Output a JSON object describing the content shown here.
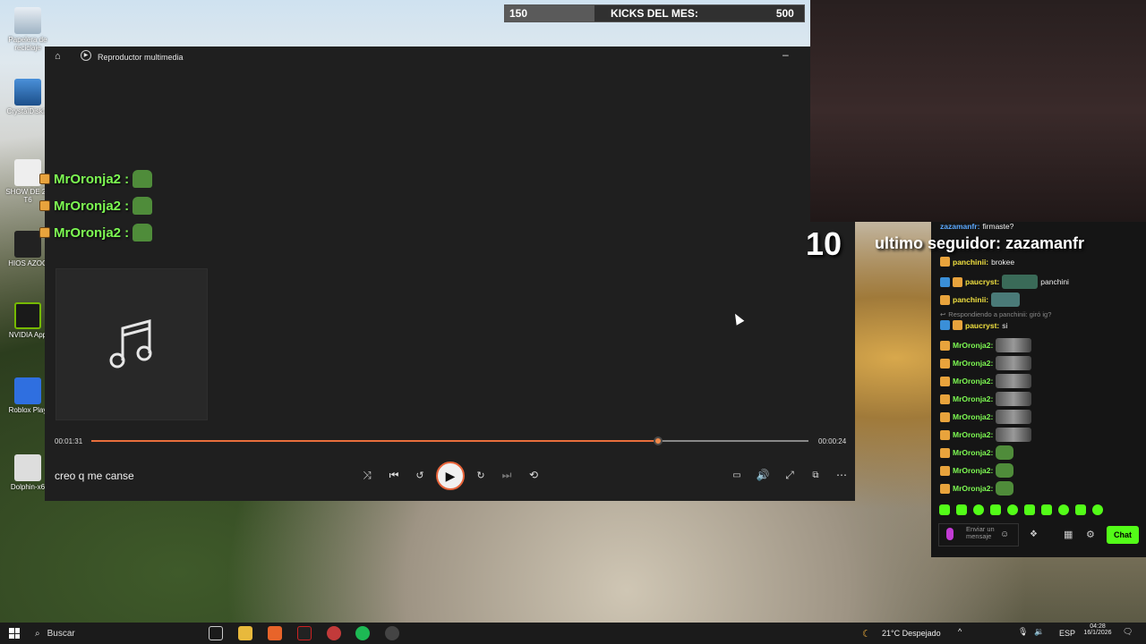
{
  "kicks": {
    "current": "150",
    "label": "KICKS DEL MES:",
    "goal": "500",
    "progress_fraction": 0.3
  },
  "desktop_icons": [
    {
      "label": "Papelera de reciclaje"
    },
    {
      "label": "CrystalDiskIn"
    },
    {
      "label": "SHOW DE 24 T6"
    },
    {
      "label": "HIOS AZOC"
    },
    {
      "label": "NVIDIA App"
    },
    {
      "label": "Roblox Play"
    },
    {
      "label": "Dolphin-x6"
    }
  ],
  "player": {
    "title": "Reproductor multimedia",
    "elapsed": "00:01:31",
    "remaining": "00:00:24",
    "progress_fraction": 0.79,
    "song_title": "creo q me canse"
  },
  "overlay_chat": [
    {
      "user": "MrOronja2 :"
    },
    {
      "user": "MrOronja2 :"
    },
    {
      "user": "MrOronja2 :"
    }
  ],
  "follower": {
    "count": "10",
    "text": "ultimo seguidor: zazamanfr"
  },
  "chat": {
    "messages": [
      {
        "user": "zazamanfr:",
        "text": "firmaste?"
      },
      {
        "user": "panchinii:",
        "text": "brokee"
      },
      {
        "user": "paucryst:",
        "text": "panchini"
      },
      {
        "user": "panchinii:",
        "text": ""
      },
      {
        "user": "",
        "text": "Respondiendo a panchinii: giró ig?"
      },
      {
        "user": "paucryst:",
        "text": "si"
      },
      {
        "user": "MrOronja2:",
        "text": ""
      },
      {
        "user": "MrOronja2:",
        "text": ""
      },
      {
        "user": "MrOronja2:",
        "text": ""
      },
      {
        "user": "MrOronja2:",
        "text": ""
      },
      {
        "user": "MrOronja2:",
        "text": ""
      },
      {
        "user": "MrOronja2:",
        "text": ""
      },
      {
        "user": "MrOronja2:",
        "text": ""
      },
      {
        "user": "MrOronja2:",
        "text": ""
      },
      {
        "user": "MrOronja2:",
        "text": ""
      }
    ],
    "input_placeholder": "Enviar un mensaje",
    "send_label": "Chat"
  },
  "taskbar": {
    "search_label": "Buscar",
    "weather": "21°C Despejado",
    "lang": "ESP",
    "time": "04:28",
    "date": "16/1/2026"
  }
}
